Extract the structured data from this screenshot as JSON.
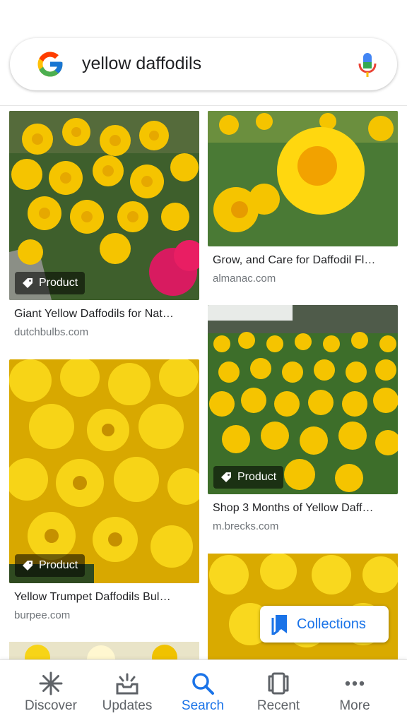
{
  "search": {
    "query": "yellow daffodils"
  },
  "results": [
    {
      "title": "Giant Yellow Daffodils for Nat…",
      "source": "dutchbulbs.com",
      "badge": "Product"
    },
    {
      "title": "Grow, and Care for Daffodil Fl…",
      "source": "almanac.com"
    },
    {
      "title": "Shop 3 Months of Yellow Daff…",
      "source": "m.brecks.com",
      "badge": "Product"
    },
    {
      "title": "Yellow Trumpet Daffodils Bul…",
      "source": "burpee.com",
      "badge": "Product"
    }
  ],
  "collections_label": "Collections",
  "nav": {
    "discover": "Discover",
    "updates": "Updates",
    "search": "Search",
    "recent": "Recent",
    "more": "More"
  },
  "colors": {
    "accent": "#1a73e8",
    "inactive": "#5f6368",
    "daffodil_yellow": "#f5c400",
    "leaf_green": "#3f6f2a"
  },
  "icons": [
    "google-logo-icon",
    "mic-icon",
    "tag-icon",
    "bookmark-icon",
    "discover-icon",
    "updates-icon",
    "search-icon",
    "recent-icon",
    "more-icon"
  ]
}
